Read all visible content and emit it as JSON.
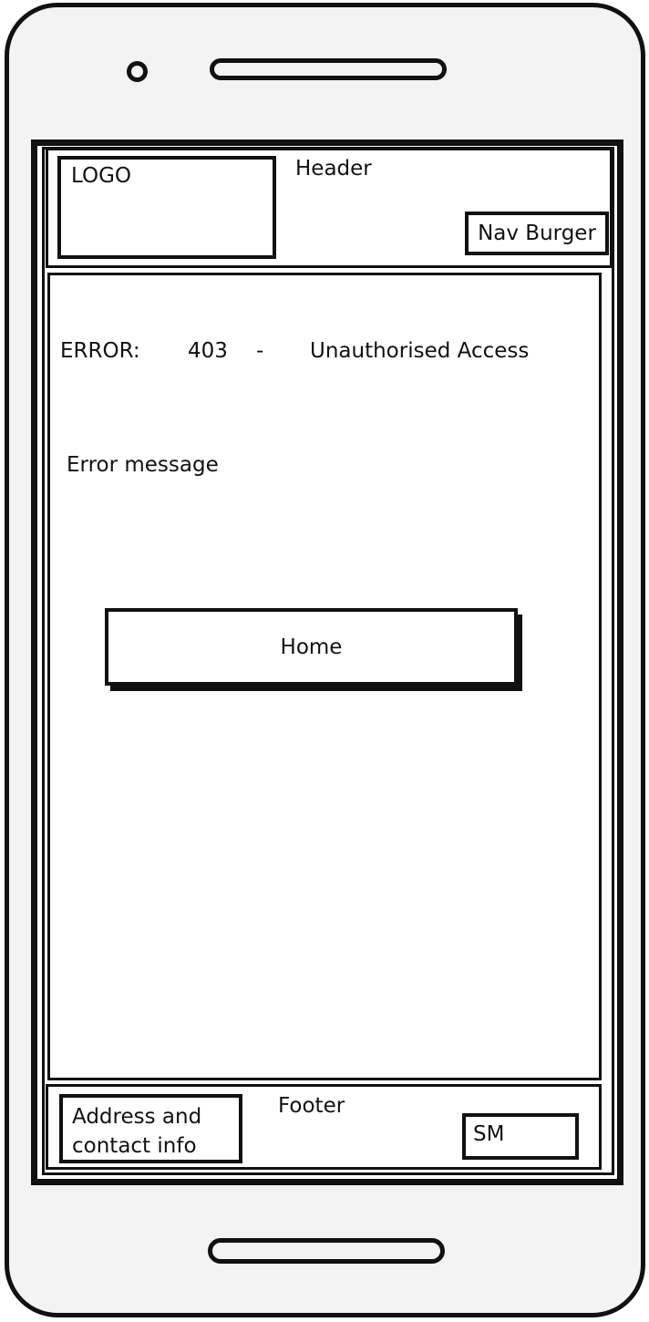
{
  "header": {
    "logo": "LOGO",
    "label": "Header",
    "nav_burger": "Nav Burger"
  },
  "main": {
    "error_label": "ERROR:",
    "error_code": "403",
    "separator": "-",
    "error_title": "Unauthorised Access",
    "error_message": "Error message",
    "home_button": "Home"
  },
  "footer": {
    "label": "Footer",
    "address_line1": "Address and",
    "address_line2": "contact info",
    "social": "SM"
  }
}
